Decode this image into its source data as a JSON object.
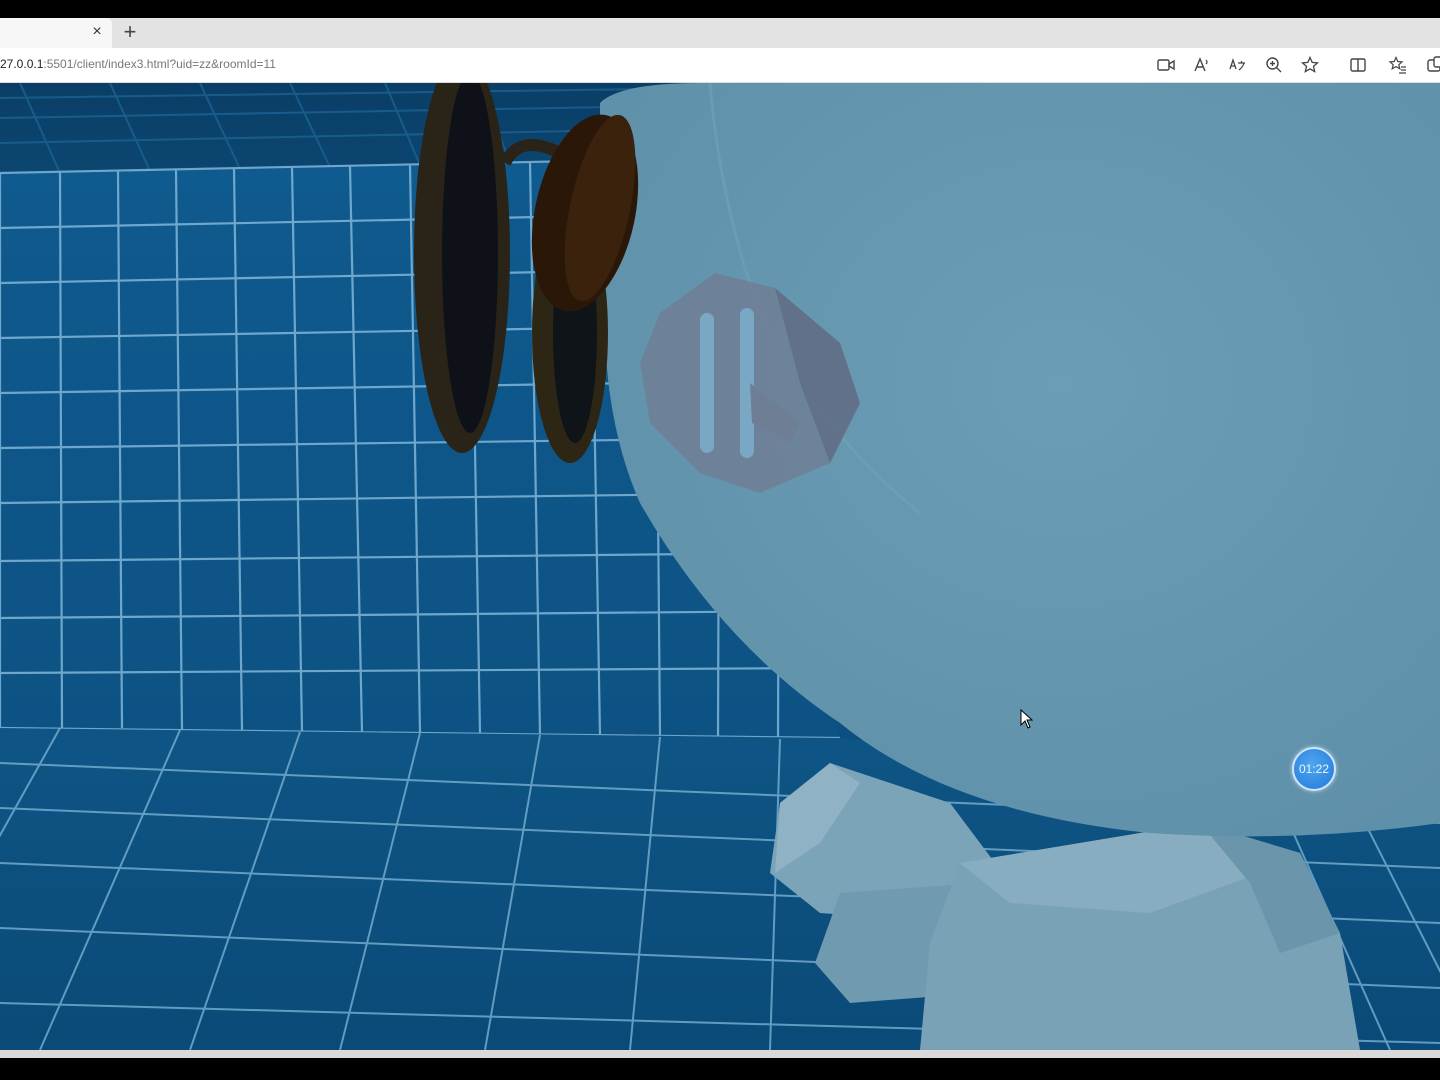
{
  "browser": {
    "tab_close_glyph": "×",
    "new_tab_glyph": "+",
    "url_host": "27.0.0.1",
    "url_rest": ":5501/client/index3.html?uid=zz&roomId=11",
    "toolbar_icons": [
      "camera-icon",
      "read-aloud-icon",
      "translate-icon",
      "zoom-icon",
      "favorite-star-icon",
      "split-screen-icon",
      "favorites-list-icon",
      "extensions-icon"
    ]
  },
  "game": {
    "timer_text": "01:22",
    "colors": {
      "wall": "#0d4f80",
      "grid_line": "#7fb6d9",
      "character_body": "#6696ad",
      "timer": "#2f86df"
    }
  }
}
